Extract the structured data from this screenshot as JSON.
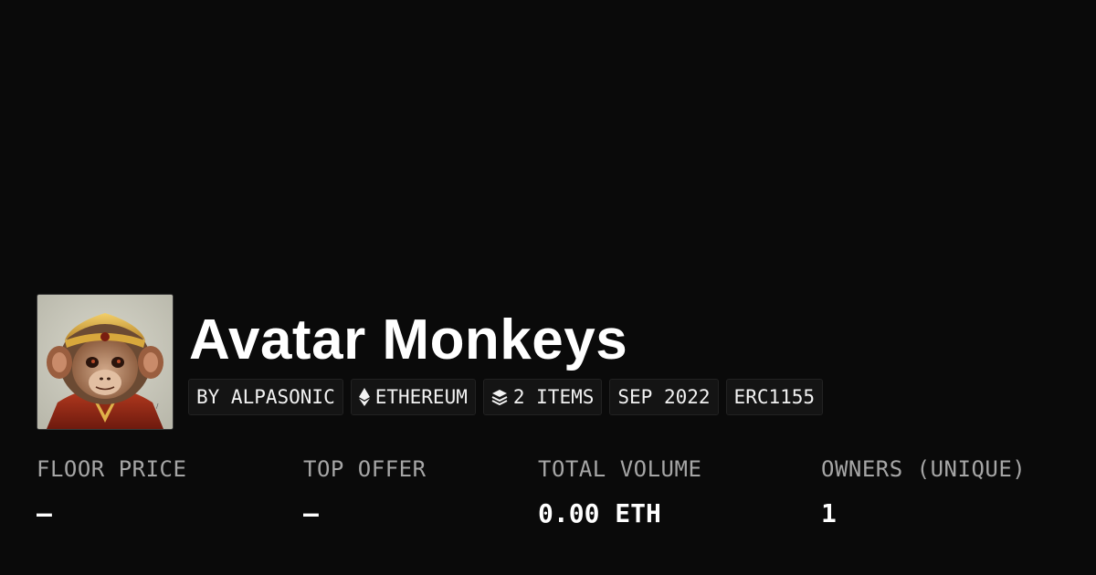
{
  "collection": {
    "title": "Avatar Monkeys",
    "avatar_alt": "monkey-avatar",
    "badges": {
      "creator": "BY ALPASONIC",
      "chain": "ETHEREUM",
      "chain_icon": "ethereum-icon",
      "items": "2 ITEMS",
      "items_icon": "layers-icon",
      "date": "SEP 2022",
      "standard": "ERC1155"
    }
  },
  "stats": {
    "floor_price": {
      "label": "FLOOR PRICE",
      "value": "–"
    },
    "top_offer": {
      "label": "TOP OFFER",
      "value": "–"
    },
    "total_volume": {
      "label": "TOTAL VOLUME",
      "value": "0.00 ETH"
    },
    "owners": {
      "label": "OWNERS (UNIQUE)",
      "value": "1"
    }
  },
  "colors": {
    "background": "#0a0a0a",
    "badge_background": "#141414",
    "label_gray": "#a6a6a6",
    "text": "#ffffff"
  }
}
